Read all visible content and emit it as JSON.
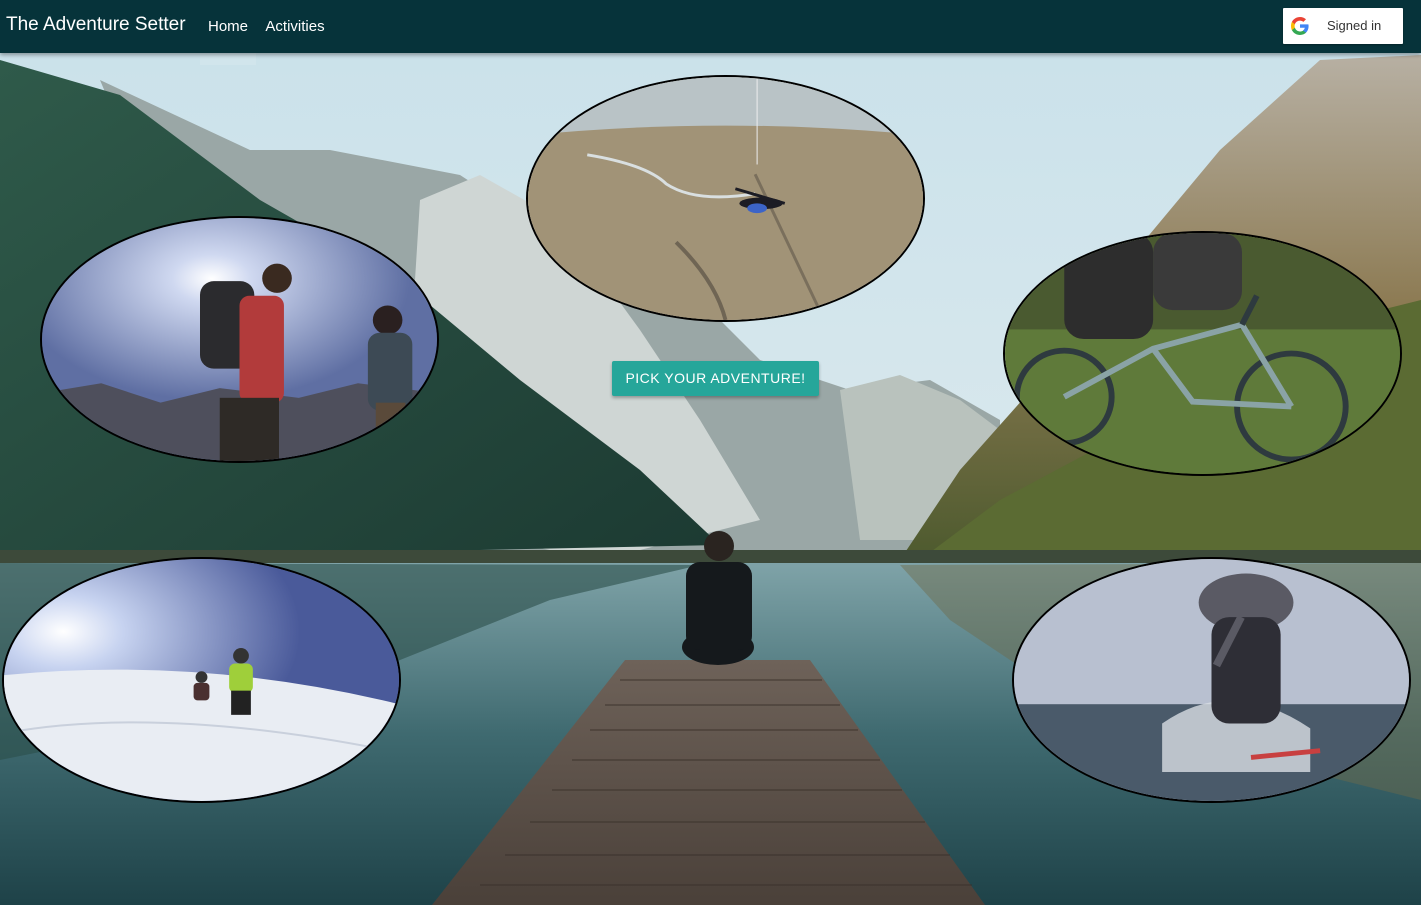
{
  "navbar": {
    "brand": "The Adventure Setter",
    "links": [
      {
        "label": "Home",
        "active": true
      },
      {
        "label": "Activities",
        "active": false
      }
    ],
    "signin": {
      "label": "Signed in",
      "icon": "google-g-icon"
    }
  },
  "hero": {
    "cta_label": "PICK YOUR ADVENTURE!",
    "cta_color": "#26a69a"
  },
  "media": [
    {
      "name": "skydiving-video",
      "description_icon": "skydiving"
    },
    {
      "name": "hiking-video",
      "description_icon": "hiking"
    },
    {
      "name": "mountain-biking-video",
      "description_icon": "mountain-biking"
    },
    {
      "name": "skiing-video",
      "description_icon": "skiing"
    },
    {
      "name": "surfing-video",
      "description_icon": "surfing"
    }
  ],
  "colors": {
    "navbar_bg": "#06333a",
    "accent": "#26a69a"
  }
}
